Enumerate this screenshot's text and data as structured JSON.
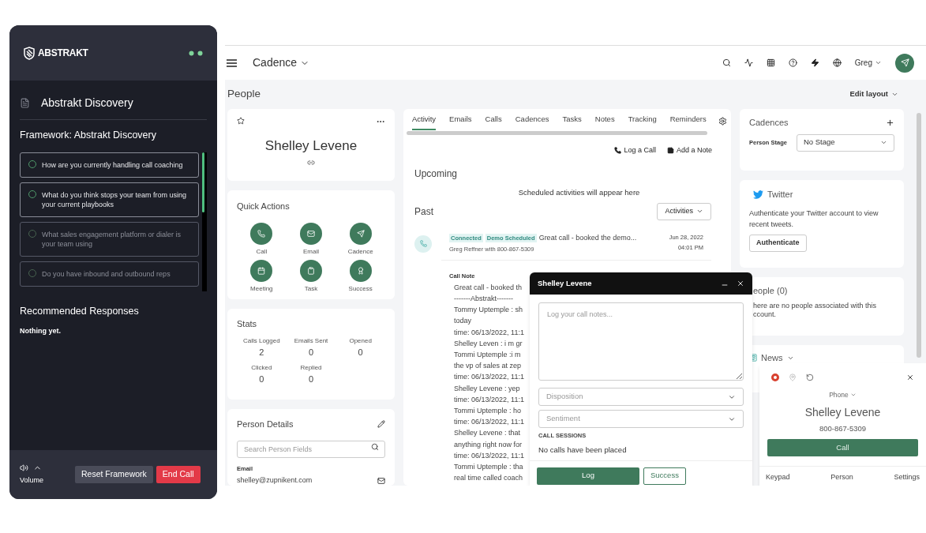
{
  "assistant": {
    "logo": "ABSTRAKT",
    "title": "Abstrakt Discovery",
    "framework": "Framework: Abstrakt Discovery",
    "questions": [
      {
        "text": "How are you currently handling call coaching",
        "disabled": false
      },
      {
        "text": "What do you think stops your team from using your current playbooks",
        "disabled": false
      },
      {
        "text": "What sales engagement platform or dialer is your team using",
        "disabled": true
      },
      {
        "text": "Do you have inbound and outbound reps",
        "disabled": true
      }
    ],
    "responses_title": "Recommended Responses",
    "responses_empty": "Nothing yet.",
    "volume_label": "Volume",
    "buttons": [
      "Reset Framework",
      "End Call"
    ]
  },
  "app": {
    "title": "Cadence",
    "user": "Greg",
    "page_title": "People",
    "edit_layout": "Edit layout"
  },
  "profile": {
    "name": "Shelley Levene"
  },
  "quick_actions": {
    "title": "Quick Actions",
    "items": [
      {
        "label": "Call",
        "kind": "call"
      },
      {
        "label": "Email",
        "kind": "email"
      },
      {
        "label": "Cadence",
        "kind": "cadence"
      },
      {
        "label": "Meeting",
        "kind": "meeting"
      },
      {
        "label": "Task",
        "kind": "task"
      },
      {
        "label": "Success",
        "kind": "success"
      }
    ]
  },
  "stats": {
    "title": "Stats",
    "items": [
      {
        "label": "Calls Logged",
        "value": "2"
      },
      {
        "label": "Emails Sent",
        "value": "0"
      },
      {
        "label": "Opened",
        "value": "0"
      },
      {
        "label": "Clicked",
        "value": "0"
      },
      {
        "label": "Replied",
        "value": "0"
      }
    ]
  },
  "person_details": {
    "title": "Person Details",
    "search_placeholder": "Search Person Fields",
    "field_label": "Email",
    "field_value": "shelley@zupnikent.com"
  },
  "activity": {
    "tabs": [
      {
        "label": "Activity",
        "selected": true
      },
      {
        "label": "Emails",
        "selected": false
      },
      {
        "label": "Calls",
        "selected": false
      },
      {
        "label": "Cadences",
        "selected": false
      },
      {
        "label": "Tasks",
        "selected": false
      },
      {
        "label": "Notes",
        "selected": false
      },
      {
        "label": "Tracking",
        "selected": false
      },
      {
        "label": "Reminders",
        "selected": false
      }
    ],
    "actions": [
      "Log a Call",
      "Add a Note"
    ],
    "upcoming_title": "Upcoming",
    "upcoming_empty": "Scheduled activities will appear here",
    "past_title": "Past",
    "filter": "Activities",
    "entry": {
      "tags": [
        "Connected",
        "Demo Scheduled"
      ],
      "summary": "Great call - booked the demo...",
      "meta": "Greg Reffner with 800-867-5309",
      "date": "Jun 28, 2022",
      "time": "04:01 PM",
      "note_label": "Call Note",
      "note_lines": [
        "Great call - booked th",
        "-------Abstrakt-------",
        "Tommy Uptemple : sh",
        "today",
        "time: 06/13/2022, 11:1",
        "Shelley Leven : i m gr",
        "Tommi Uptemple :i m",
        "the vp of sales at zep",
        "time: 06/13/2022, 11:1",
        "Shelley Levene : yep",
        "time: 06/13/2022, 11:1",
        "Tommi Uptemple : ho",
        "time: 06/13/2022, 11:1",
        "Shelley Levene : that",
        "anything right now for",
        "time: 06/13/2022, 11:1",
        "Tommi Uptemple : tha",
        "real time called coach"
      ]
    }
  },
  "cadences": {
    "title": "Cadences",
    "stage_label": "Person Stage",
    "stage_value": "No Stage"
  },
  "twitter": {
    "title": "Twitter",
    "text": "Authenticate your Twitter account to view recent tweets.",
    "button": "Authenticate"
  },
  "people": {
    "title": "eople (0)",
    "lines": [
      "here are no people associated with this",
      "ccount."
    ]
  },
  "news": {
    "title": "News"
  },
  "call_log": {
    "title": "Shelley Levene",
    "notes_placeholder": "Log your call notes...",
    "disposition_placeholder": "Disposition",
    "sentiment_placeholder": "Sentiment",
    "sessions_label": "CALL SESSIONS",
    "sessions_empty": "No calls have been placed",
    "buttons": [
      "Log",
      "Success"
    ]
  },
  "dialer": {
    "line": "Phone",
    "name": "Shelley Levene",
    "number": "800-867-5309",
    "call_button": "Call",
    "nav": [
      "Keypad",
      "Person",
      "Settings"
    ]
  }
}
